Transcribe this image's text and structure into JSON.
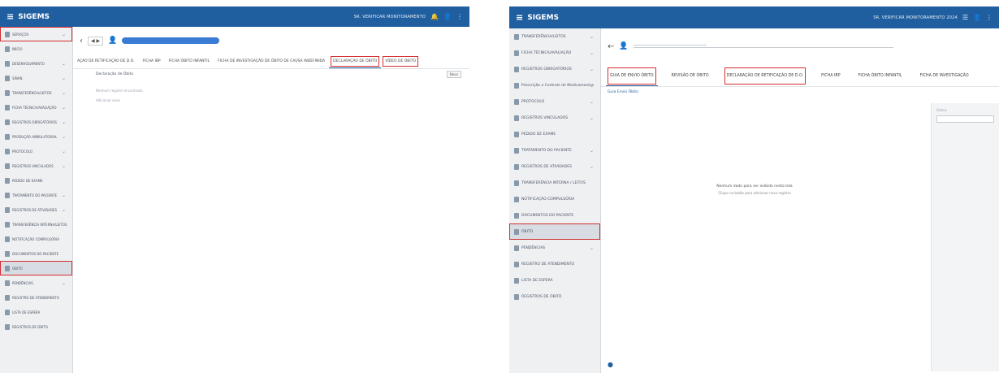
{
  "left": {
    "app_name": "SIGEMS",
    "topbar_user": "SR. VERIFICAR MONITORAMENTO",
    "sidebar": {
      "items": [
        {
          "label": "SERVIÇOS",
          "active": false,
          "boxed": true,
          "chevron": true
        },
        {
          "label": "INÍCIO",
          "active": false,
          "boxed": false,
          "chevron": false
        },
        {
          "label": "DESENVOLVIMENTO",
          "active": false,
          "boxed": false,
          "chevron": true
        },
        {
          "label": "SINAN",
          "active": false,
          "boxed": false,
          "chevron": true
        },
        {
          "label": "TRANSFERÊNCIA/LEITOS",
          "active": false,
          "boxed": false,
          "chevron": true
        },
        {
          "label": "FICHA TÉCNICA/AVALIAÇÃO",
          "active": false,
          "boxed": false,
          "chevron": true
        },
        {
          "label": "REGISTROS OBRIGATÓRIOS",
          "active": false,
          "boxed": false,
          "chevron": true
        },
        {
          "label": "PRODUÇÃO AMBULATORIAL",
          "active": false,
          "boxed": false,
          "chevron": true
        },
        {
          "label": "PROTOCOLO",
          "active": false,
          "boxed": false,
          "chevron": true
        },
        {
          "label": "REGISTROS VINCULADOS",
          "active": false,
          "boxed": false,
          "chevron": true
        },
        {
          "label": "PEDIDO DE EXAME",
          "active": false,
          "boxed": false,
          "chevron": false
        },
        {
          "label": "TRATAMENTO DO PACIENTE",
          "active": false,
          "boxed": false,
          "chevron": true
        },
        {
          "label": "REGISTROS DE ATIVIDADES",
          "active": false,
          "boxed": false,
          "chevron": true
        },
        {
          "label": "TRANSFERÊNCIA INTERNA/LEITOS",
          "active": false,
          "boxed": false,
          "chevron": false
        },
        {
          "label": "NOTIFICAÇÃO COMPULSÓRIA",
          "active": false,
          "boxed": false,
          "chevron": false
        },
        {
          "label": "DOCUMENTOS DO PACIENTE",
          "active": false,
          "boxed": false,
          "chevron": false
        },
        {
          "label": "ÓBITO",
          "active": true,
          "boxed": true,
          "chevron": false
        },
        {
          "label": "PENDÊNCIAS",
          "active": false,
          "boxed": false,
          "chevron": true
        },
        {
          "label": "REGISTRO DE ATENDIMENTO",
          "active": false,
          "boxed": false,
          "chevron": false
        },
        {
          "label": "LISTA DE ESPERA",
          "active": false,
          "boxed": false,
          "chevron": false
        },
        {
          "label": "REGISTROS DE ÓBITO",
          "active": false,
          "boxed": false,
          "chevron": false
        }
      ]
    },
    "crumb": {
      "nav": "◀ ▶"
    },
    "tabs": [
      {
        "label": "AÇÃO DE RETIFICAÇÃO DE D.O.",
        "active": false,
        "boxed": false
      },
      {
        "label": "FICHA IBP",
        "active": false,
        "boxed": false
      },
      {
        "label": "FICHA ÓBITO INFANTIL",
        "active": false,
        "boxed": false
      },
      {
        "label": "FICHA DE INVESTIGAÇÃO DE ÓBITO DE CAUSA INDEFINIDA",
        "active": false,
        "boxed": false
      },
      {
        "label": "DECLARAÇÃO DE ÓBITO",
        "active": true,
        "boxed": true
      },
      {
        "label": "VÍDEO DE ÓBITO",
        "active": false,
        "boxed": true
      }
    ],
    "content": {
      "heading": "Declaração de Óbito",
      "line1": "Nenhum registro encontrado",
      "line2": "Adicionar novo",
      "button": "Novo"
    }
  },
  "right": {
    "app_name": "SIGEMS",
    "topbar_user": "SR. VERIFICAR MONITORAMENTO 2024",
    "sidebar": {
      "items": [
        {
          "label": "TRANSFERÊNCIA/LEITOS",
          "active": false,
          "boxed": false,
          "chevron": true
        },
        {
          "label": "FICHA TÉCNICA/AVALIAÇÃO",
          "active": false,
          "boxed": false,
          "chevron": true
        },
        {
          "label": "REGISTROS OBRIGATÓRIOS",
          "active": false,
          "boxed": false,
          "chevron": true
        },
        {
          "label": "Prescrição e Controle de Medicamentos",
          "active": false,
          "boxed": false,
          "chevron": true
        },
        {
          "label": "PROTOCOLO",
          "active": false,
          "boxed": false,
          "chevron": true
        },
        {
          "label": "REGISTROS VINCULADOS",
          "active": false,
          "boxed": false,
          "chevron": true
        },
        {
          "label": "PEDIDO DE EXAME",
          "active": false,
          "boxed": false,
          "chevron": false
        },
        {
          "label": "TRATAMENTO DO PACIENTE",
          "active": false,
          "boxed": false,
          "chevron": true
        },
        {
          "label": "REGISTROS DE ATIVIDADES",
          "active": false,
          "boxed": false,
          "chevron": true
        },
        {
          "label": "TRANSFERÊNCIA INTERNA / LEITOS",
          "active": false,
          "boxed": false,
          "chevron": false
        },
        {
          "label": "NOTIFICAÇÃO COMPULSÓRIA",
          "active": false,
          "boxed": false,
          "chevron": false
        },
        {
          "label": "DOCUMENTOS DO PACIENTE",
          "active": false,
          "boxed": false,
          "chevron": false
        },
        {
          "label": "ÓBITO",
          "active": true,
          "boxed": true,
          "chevron": false
        },
        {
          "label": "PENDÊNCIAS",
          "active": false,
          "boxed": false,
          "chevron": true
        },
        {
          "label": "REGISTRO DE ATENDIMENTO",
          "active": false,
          "boxed": false,
          "chevron": false
        },
        {
          "label": "LISTA DE ESPERA",
          "active": false,
          "boxed": false,
          "chevron": false
        },
        {
          "label": "REGISTROS DE ÓBITO",
          "active": false,
          "boxed": false,
          "chevron": false
        }
      ]
    },
    "tabs": [
      {
        "label": "GUIA DE ENVIO ÓBITO",
        "active": true,
        "boxed": true
      },
      {
        "label": "REVISÃO DE ÓBITO",
        "active": false,
        "boxed": false
      },
      {
        "label": "DECLARAÇÃO DE RETIFICAÇÃO DE D.O.",
        "active": false,
        "boxed": true
      },
      {
        "label": "FICHA IBP",
        "active": false,
        "boxed": false
      },
      {
        "label": "FICHA ÓBITO INFANTIL",
        "active": false,
        "boxed": false
      },
      {
        "label": "FICHA DE INVESTIGAÇÃO",
        "active": false,
        "boxed": false
      }
    ],
    "content": {
      "section_title": "Guia Envio Óbito",
      "empty_title": "Nenhum dado para ser exibido nesta tela",
      "empty_sub": "Clique no botão para adicionar novo registro",
      "side_label": "Status"
    }
  }
}
